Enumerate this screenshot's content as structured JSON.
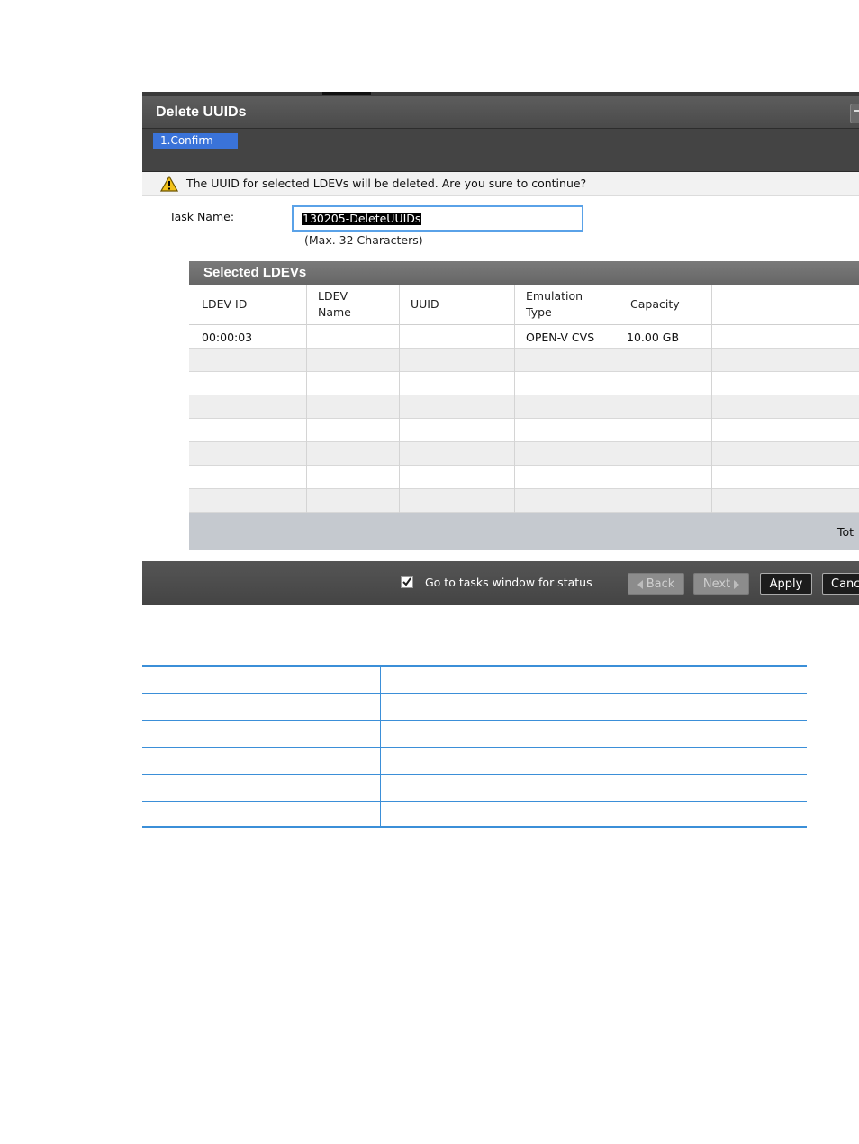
{
  "dialog": {
    "title": "Delete UUIDs",
    "step_label": "1.Confirm",
    "warning_icon": "warning-triangle-icon",
    "warning_text": "The UUID for selected LDEVs will be deleted. Are you sure to continue?",
    "task_name_label": "Task Name:",
    "task_name_value": "130205-DeleteUUIDs",
    "task_name_hint": "(Max. 32 Characters)"
  },
  "panel": {
    "title": "Selected LDEVs",
    "columns": {
      "ldev_id": "LDEV ID",
      "ldev_name_1": "LDEV",
      "ldev_name_2": "Name",
      "uuid": "UUID",
      "emulation_1": "Emulation",
      "emulation_2": "Type",
      "capacity": "Capacity"
    },
    "rows": [
      {
        "ldev_id": "00:00:03",
        "ldev_name": "",
        "uuid": "",
        "emulation": "OPEN-V CVS",
        "capacity": "10.00 GB"
      }
    ],
    "footer_text": "Tot"
  },
  "buttons": {
    "goto_tasks_label": "Go to tasks window for status",
    "goto_tasks_checked": true,
    "back": "Back",
    "next": "Next",
    "apply": "Apply",
    "cancel": "Canc"
  },
  "colors": {
    "accent": "#3a73d9",
    "input_border": "#5aa2e8",
    "doc_table_line": "#3b8fd8"
  }
}
